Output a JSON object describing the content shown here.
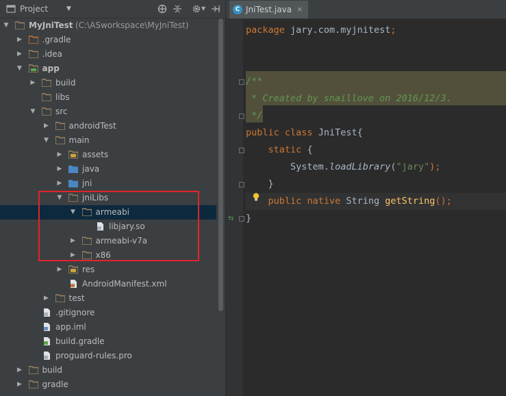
{
  "toolbar": {
    "title": "Project",
    "dropdown": "▼",
    "icons": [
      "sync-icon",
      "collapse-icon",
      "settings-icon",
      "hide-icon"
    ]
  },
  "tree": [
    {
      "name": "MyJniTest",
      "path": "(C:\\ASworkspace\\MyJniTest)",
      "depth": 0,
      "expanded": true,
      "bold": true,
      "icon": "project-folder-icon"
    },
    {
      "name": ".gradle",
      "depth": 1,
      "expanded": false,
      "icon": "folder-orange-icon"
    },
    {
      "name": ".idea",
      "depth": 1,
      "expanded": false,
      "icon": "folder-icon"
    },
    {
      "name": "app",
      "depth": 1,
      "expanded": true,
      "bold": true,
      "icon": "module-folder-icon"
    },
    {
      "name": "build",
      "depth": 2,
      "expanded": false,
      "icon": "folder-icon"
    },
    {
      "name": "libs",
      "depth": 2,
      "leafFolder": true,
      "icon": "folder-icon"
    },
    {
      "name": "src",
      "depth": 2,
      "expanded": true,
      "icon": "folder-icon"
    },
    {
      "name": "androidTest",
      "depth": 3,
      "expanded": false,
      "icon": "folder-icon"
    },
    {
      "name": "main",
      "depth": 3,
      "expanded": true,
      "icon": "folder-icon"
    },
    {
      "name": "assets",
      "depth": 4,
      "expanded": false,
      "icon": "resource-folder-icon"
    },
    {
      "name": "java",
      "depth": 4,
      "expanded": false,
      "icon": "source-folder-icon"
    },
    {
      "name": "jni",
      "depth": 4,
      "expanded": false,
      "icon": "source-folder-icon"
    },
    {
      "name": "jniLibs",
      "depth": 4,
      "expanded": true,
      "icon": "folder-icon"
    },
    {
      "name": "armeabi",
      "depth": 5,
      "expanded": true,
      "selected": true,
      "icon": "folder-icon"
    },
    {
      "name": "libjary.so",
      "depth": 6,
      "file": true,
      "icon": "file-icon"
    },
    {
      "name": "armeabi-v7a",
      "depth": 5,
      "expanded": false,
      "icon": "folder-icon"
    },
    {
      "name": "x86",
      "depth": 5,
      "expanded": false,
      "icon": "folder-icon"
    },
    {
      "name": "res",
      "depth": 4,
      "expanded": false,
      "icon": "resource-folder-icon"
    },
    {
      "name": "AndroidManifest.xml",
      "depth": 4,
      "file": true,
      "icon": "manifest-file-icon"
    },
    {
      "name": "test",
      "depth": 3,
      "expanded": false,
      "icon": "folder-icon"
    },
    {
      "name": ".gitignore",
      "depth": 2,
      "file": true,
      "icon": "text-file-icon"
    },
    {
      "name": "app.iml",
      "depth": 2,
      "file": true,
      "icon": "iml-file-icon"
    },
    {
      "name": "build.gradle",
      "depth": 2,
      "file": true,
      "icon": "gradle-file-icon"
    },
    {
      "name": "proguard-rules.pro",
      "depth": 2,
      "file": true,
      "icon": "text-file-icon"
    },
    {
      "name": "build",
      "depth": 1,
      "expanded": false,
      "icon": "folder-icon"
    },
    {
      "name": "gradle",
      "depth": 1,
      "expanded": false,
      "icon": "folder-icon"
    }
  ],
  "editor": {
    "tab": {
      "label": "JniTest.java",
      "icon_letter": "C",
      "close": "×"
    },
    "code": {
      "package_kw": "package",
      "package_name": "jary.com.myjnitest",
      "package_end": ";",
      "comment_open": "/**",
      "comment_body": " * Created by snaillove on 2016/12/3.",
      "comment_close": " */",
      "class_public": "public",
      "class_kw": "class",
      "class_name": "JniTest{",
      "static_kw": "static",
      "static_brace": "{",
      "system": "System.",
      "load_method": "loadLibrary",
      "load_open": "(",
      "load_string": "\"jary\"",
      "load_close": ");",
      "close_brace": "}",
      "native_public": "public",
      "native_kw": "native",
      "native_type": "String",
      "native_method": "getString",
      "native_end": "();",
      "class_close": "}"
    }
  },
  "colors": {
    "selection": "#0d293e",
    "highlight_box": "#e2232a",
    "keyword": "#cc7832",
    "comment": "#629755",
    "string": "#6a8759",
    "method": "#ffc66d"
  }
}
